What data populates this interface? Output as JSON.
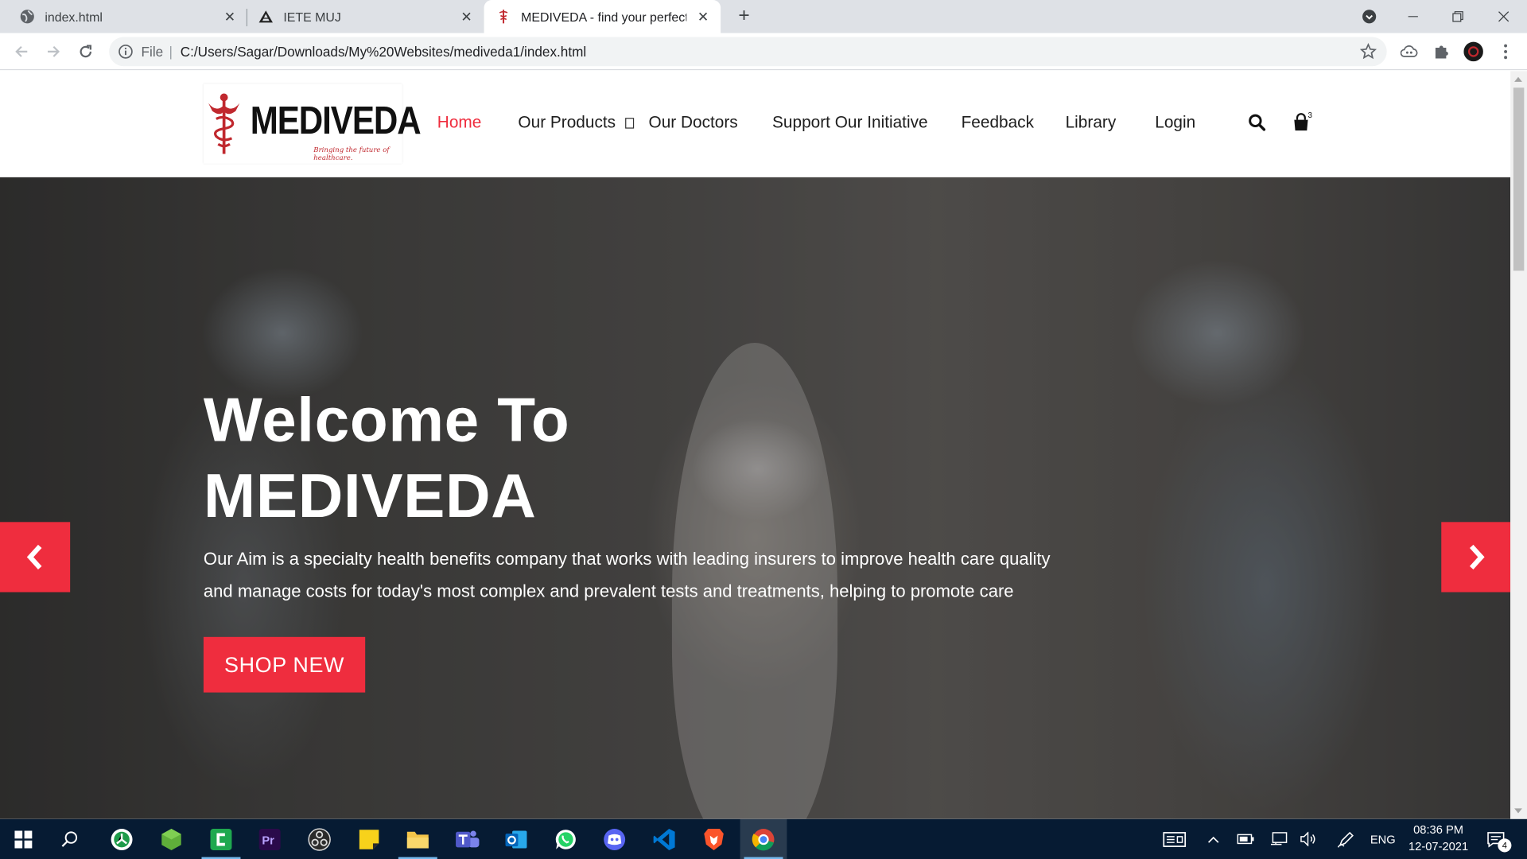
{
  "browser": {
    "tabs": [
      {
        "title": "index.html",
        "icon": "globe-icon",
        "active": false
      },
      {
        "title": "IETE MUJ",
        "icon": "iete-logo-icon",
        "active": false
      },
      {
        "title": "MEDIVEDA - find your perfect gift",
        "icon": "mediveda-favicon-icon",
        "active": true
      }
    ],
    "address": {
      "scheme": "File",
      "url": "C:/Users/Sagar/Downloads/My%20Websites/mediveda1/index.html"
    }
  },
  "site": {
    "logo": {
      "name": "MEDIVEDA",
      "tagline": "Bringing the future of healthcare."
    },
    "nav": {
      "items": [
        {
          "label": "Home",
          "active": true
        },
        {
          "label": "Our Products",
          "has_dropdown": true
        },
        {
          "label": "Our Doctors"
        },
        {
          "label": "Support Our Initiative"
        },
        {
          "label": "Feedback"
        },
        {
          "label": "Library"
        },
        {
          "label": "Login"
        }
      ],
      "cart_count": "3"
    },
    "hero": {
      "title_line1": "Welcome To",
      "title_line2": "MEDIVEDA",
      "description": "Our Aim is a specialty health benefits company that works with leading insurers to improve health care quality and manage costs for today's most complex and prevalent tests and treatments, helping to promote care",
      "button": "SHOP NEW"
    },
    "accent_color": "#ef2d3e"
  },
  "taskbar": {
    "apps": [
      "windows-start",
      "search",
      "app-circle",
      "app-hexagon",
      "camtasia",
      "premiere-pro",
      "obs",
      "sticky-notes",
      "file-explorer",
      "teams",
      "outlook",
      "whatsapp",
      "discord",
      "vscode",
      "brave",
      "chrome"
    ],
    "language": "ENG",
    "time": "08:36 PM",
    "date": "12-07-2021",
    "notifications": "4"
  }
}
